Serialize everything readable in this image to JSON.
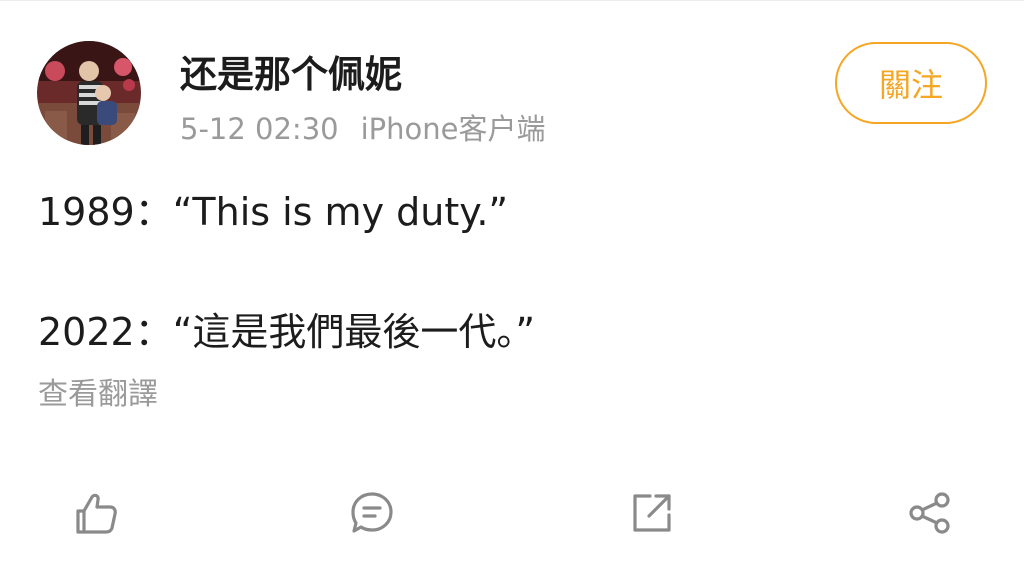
{
  "post": {
    "username": "还是那个佩妮",
    "time": "5-12 02:30",
    "source": "iPhone客户端",
    "follow_label": "關注",
    "line1": "1989：“This is my duty.”",
    "line2": "2022：“這是我們最後一代。”",
    "translate_label": "查看翻譯"
  },
  "actions": [
    {
      "icon": "thumbs-up-icon"
    },
    {
      "icon": "comment-icon"
    },
    {
      "icon": "repost-icon"
    },
    {
      "icon": "share-icon"
    }
  ],
  "colors": {
    "accent": "#f5a623",
    "text": "#1c1c1c",
    "muted": "#9a9a9a",
    "icon": "#8a8a8a"
  }
}
